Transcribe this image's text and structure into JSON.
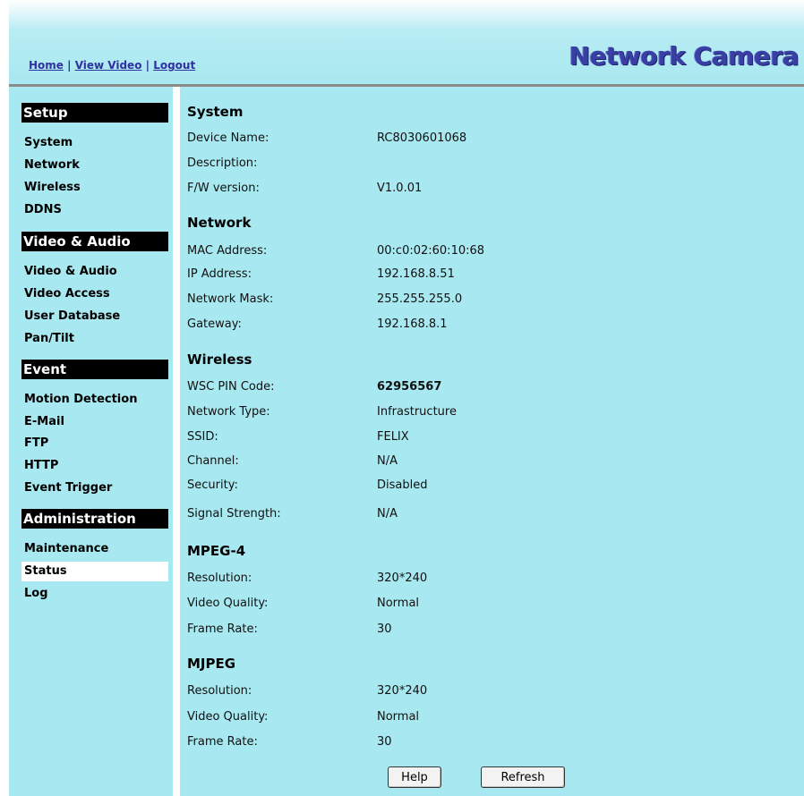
{
  "header": {
    "links": [
      "Home",
      "View Video",
      "Logout"
    ],
    "separator": " | ",
    "brand": "Network Camera"
  },
  "sidebar": {
    "sections": [
      {
        "title": "Setup",
        "items": [
          "System",
          "Network",
          "Wireless",
          "DDNS"
        ]
      },
      {
        "title": "Video & Audio",
        "items": [
          "Video & Audio",
          "Video Access",
          "User Database",
          "Pan/Tilt"
        ]
      },
      {
        "title": "Event",
        "items": [
          "Motion Detection",
          "E-Mail",
          "FTP",
          "HTTP",
          "Event Trigger"
        ]
      },
      {
        "title": "Administration",
        "items": [
          "Maintenance",
          "Status",
          "Log"
        ]
      }
    ],
    "active_item": "Status"
  },
  "main": {
    "groups": [
      {
        "title": "System",
        "rows": [
          {
            "label": "Device Name:",
            "value": "RC8030601068"
          },
          {
            "label": "Description:",
            "value": ""
          },
          {
            "label": "F/W version:",
            "value": "V1.0.01"
          }
        ]
      },
      {
        "title": "Network",
        "rows": [
          {
            "label": "MAC Address:",
            "value": "00:c0:02:60:10:68"
          },
          {
            "label": "IP Address:",
            "value": "192.168.8.51"
          },
          {
            "label": "Network Mask:",
            "value": "255.255.255.0"
          },
          {
            "label": "Gateway:",
            "value": "192.168.8.1"
          }
        ]
      },
      {
        "title": "Wireless",
        "rows": [
          {
            "label": "WSC PIN Code:",
            "value": "62956567",
            "bold": true
          },
          {
            "label": "Network Type:",
            "value": "Infrastructure"
          },
          {
            "label": "SSID:",
            "value": "FELIX"
          },
          {
            "label": "Channel:",
            "value": "N/A"
          },
          {
            "label": "Security:",
            "value": "Disabled"
          },
          {
            "label": "Signal Strength:",
            "value": "N/A"
          }
        ]
      },
      {
        "title": "MPEG-4",
        "rows": [
          {
            "label": "Resolution:",
            "value": "320*240"
          },
          {
            "label": "Video Quality:",
            "value": "Normal"
          },
          {
            "label": "Frame Rate:",
            "value": "30"
          }
        ]
      },
      {
        "title": "MJPEG",
        "rows": [
          {
            "label": "Resolution:",
            "value": "320*240"
          },
          {
            "label": "Video Quality:",
            "value": "Normal"
          },
          {
            "label": "Frame Rate:",
            "value": "30"
          }
        ]
      }
    ],
    "buttons": {
      "help": "Help",
      "refresh": "Refresh"
    }
  },
  "colors": {
    "panel_bg": "#a8e8f0",
    "brand": "#3a3fa3",
    "section_bg": "#000000"
  }
}
